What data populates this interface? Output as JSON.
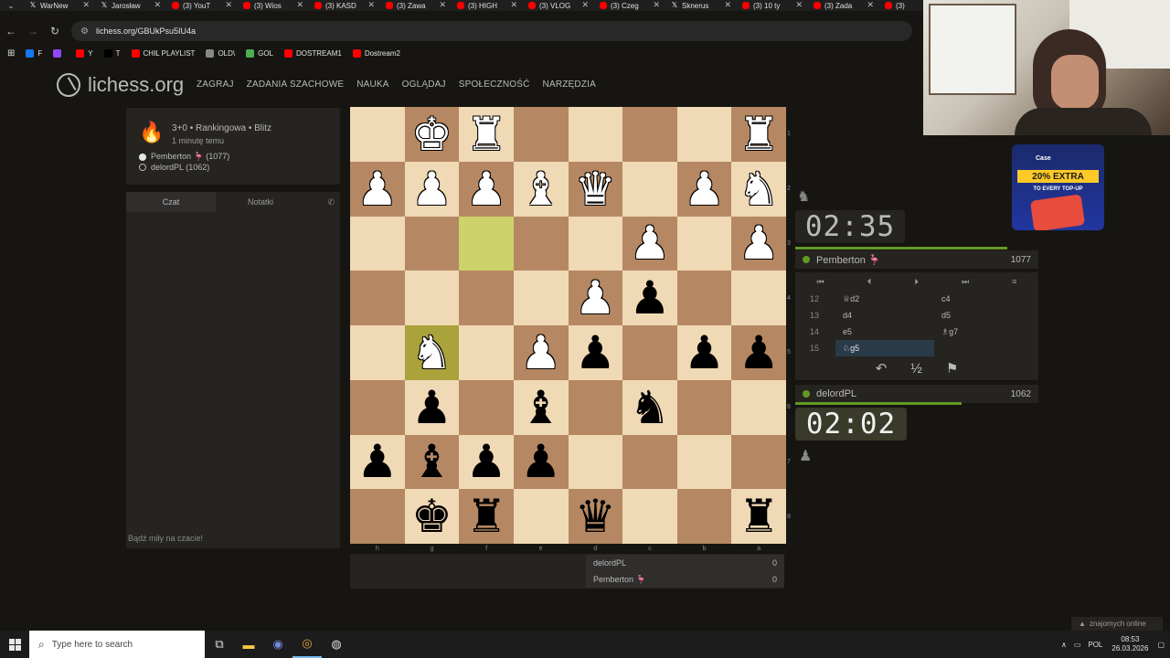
{
  "browser": {
    "tabs": [
      {
        "label": "WarNew",
        "icon": "x-icon"
      },
      {
        "label": "Jarosław",
        "icon": "x-icon"
      },
      {
        "label": "(3) YouT",
        "icon": "youtube-icon"
      },
      {
        "label": "(3) Wios",
        "icon": "youtube-icon"
      },
      {
        "label": "(3) KASD",
        "icon": "youtube-icon"
      },
      {
        "label": "(3) Zawa",
        "icon": "youtube-icon"
      },
      {
        "label": "(3) HIGH",
        "icon": "youtube-icon"
      },
      {
        "label": "(3) VLOG",
        "icon": "youtube-icon"
      },
      {
        "label": "(3) Czeg",
        "icon": "youtube-icon"
      },
      {
        "label": "Sknerus",
        "icon": "x-icon"
      },
      {
        "label": "(3) 10 ty",
        "icon": "youtube-icon"
      },
      {
        "label": "(3) Zada",
        "icon": "youtube-icon"
      },
      {
        "label": "(3)",
        "icon": "youtube-icon"
      }
    ],
    "url": "lichess.org/GBUkPsu5IU4a",
    "bookmarks": [
      {
        "label": "F",
        "color": "#1877f2"
      },
      {
        "label": "",
        "color": "#9146ff"
      },
      {
        "label": "Y",
        "color": "#ff0000"
      },
      {
        "label": "T",
        "color": "#000000"
      },
      {
        "label": "CHIL PLAYLIST",
        "color": "#ff0000"
      },
      {
        "label": "OLD\\",
        "color": "#888888"
      },
      {
        "label": "GOL",
        "color": "#4caf50"
      },
      {
        "label": "DOSTREAM1",
        "color": "#ff0000"
      },
      {
        "label": "Dostream2",
        "color": "#ff0000"
      }
    ]
  },
  "site": {
    "logo": "lichess.org",
    "nav": [
      "ZAGRAJ",
      "ZADANIA SZACHOWE",
      "NAUKA",
      "OGLĄDAJ",
      "SPOŁECZNOŚĆ",
      "NARZĘDZIA"
    ]
  },
  "game": {
    "type": "3+0 • Rankingowa • Blitz",
    "time_ago": "1 minutę temu",
    "white_player": "Pemberton 🦩 (1077)",
    "black_player": "delordPL (1062)"
  },
  "chat": {
    "tab_chat": "Czat",
    "tab_notes": "Notatki",
    "placeholder": "Bądź miły na czacie!"
  },
  "board": {
    "ranks": [
      [
        "",
        "K",
        "R",
        "",
        "",
        "",
        "",
        "R"
      ],
      [
        "P",
        "P",
        "P",
        "B",
        "Q",
        "",
        "P",
        "N"
      ],
      [
        "",
        "",
        "",
        "",
        "",
        "P",
        "",
        "P"
      ],
      [
        "",
        "",
        "",
        "",
        "P",
        "p",
        "",
        ""
      ],
      [
        "",
        "N",
        "",
        "P",
        "p",
        "",
        "p",
        "p"
      ],
      [
        "",
        "p",
        "",
        "b",
        "",
        "n",
        "",
        ""
      ],
      [
        "p",
        "b",
        "p",
        "p",
        "",
        "",
        "",
        ""
      ],
      [
        "",
        "k",
        "r",
        "",
        "q",
        "",
        "",
        "r"
      ]
    ],
    "highlights": [
      "2,2",
      "4,1"
    ],
    "file_labels": [
      "h",
      "g",
      "f",
      "e",
      "d",
      "c",
      "b",
      "a"
    ],
    "rank_labels": [
      "1",
      "2",
      "3",
      "4",
      "5",
      "6",
      "7",
      "8"
    ]
  },
  "clocks": {
    "top": {
      "time": "02:35",
      "player": "Pemberton 🦩",
      "rating": "1077"
    },
    "bottom": {
      "time": "02:02",
      "player": "delordPL",
      "rating": "1062"
    }
  },
  "moves": [
    {
      "n": "12",
      "w": "♕d2",
      "b": "c4"
    },
    {
      "n": "13",
      "w": "d4",
      "b": "d5"
    },
    {
      "n": "14",
      "w": "e5",
      "b": "♗g7"
    },
    {
      "n": "15",
      "w": "♘g5",
      "b": ""
    }
  ],
  "crosstable": [
    {
      "name": "delordPL",
      "score": "0"
    },
    {
      "name": "Pemberton 🦩",
      "score": "0"
    }
  ],
  "ad": {
    "brand": "Case",
    "headline": "20% EXTRA",
    "sub": "TO EVERY TOP-UP"
  },
  "friends": "znajomych online",
  "taskbar": {
    "search_placeholder": "Type here to search",
    "lang": "POL",
    "time": "08:53",
    "date": "26.03.2026"
  }
}
